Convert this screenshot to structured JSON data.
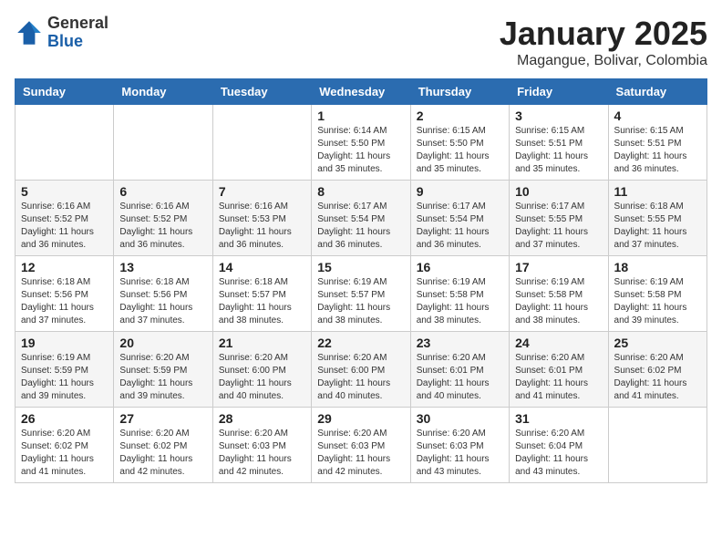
{
  "logo": {
    "general": "General",
    "blue": "Blue"
  },
  "title": "January 2025",
  "location": "Magangue, Bolivar, Colombia",
  "days_of_week": [
    "Sunday",
    "Monday",
    "Tuesday",
    "Wednesday",
    "Thursday",
    "Friday",
    "Saturday"
  ],
  "weeks": [
    [
      {
        "day": "",
        "info": ""
      },
      {
        "day": "",
        "info": ""
      },
      {
        "day": "",
        "info": ""
      },
      {
        "day": "1",
        "info": "Sunrise: 6:14 AM\nSunset: 5:50 PM\nDaylight: 11 hours\nand 35 minutes."
      },
      {
        "day": "2",
        "info": "Sunrise: 6:15 AM\nSunset: 5:50 PM\nDaylight: 11 hours\nand 35 minutes."
      },
      {
        "day": "3",
        "info": "Sunrise: 6:15 AM\nSunset: 5:51 PM\nDaylight: 11 hours\nand 35 minutes."
      },
      {
        "day": "4",
        "info": "Sunrise: 6:15 AM\nSunset: 5:51 PM\nDaylight: 11 hours\nand 36 minutes."
      }
    ],
    [
      {
        "day": "5",
        "info": "Sunrise: 6:16 AM\nSunset: 5:52 PM\nDaylight: 11 hours\nand 36 minutes."
      },
      {
        "day": "6",
        "info": "Sunrise: 6:16 AM\nSunset: 5:52 PM\nDaylight: 11 hours\nand 36 minutes."
      },
      {
        "day": "7",
        "info": "Sunrise: 6:16 AM\nSunset: 5:53 PM\nDaylight: 11 hours\nand 36 minutes."
      },
      {
        "day": "8",
        "info": "Sunrise: 6:17 AM\nSunset: 5:54 PM\nDaylight: 11 hours\nand 36 minutes."
      },
      {
        "day": "9",
        "info": "Sunrise: 6:17 AM\nSunset: 5:54 PM\nDaylight: 11 hours\nand 36 minutes."
      },
      {
        "day": "10",
        "info": "Sunrise: 6:17 AM\nSunset: 5:55 PM\nDaylight: 11 hours\nand 37 minutes."
      },
      {
        "day": "11",
        "info": "Sunrise: 6:18 AM\nSunset: 5:55 PM\nDaylight: 11 hours\nand 37 minutes."
      }
    ],
    [
      {
        "day": "12",
        "info": "Sunrise: 6:18 AM\nSunset: 5:56 PM\nDaylight: 11 hours\nand 37 minutes."
      },
      {
        "day": "13",
        "info": "Sunrise: 6:18 AM\nSunset: 5:56 PM\nDaylight: 11 hours\nand 37 minutes."
      },
      {
        "day": "14",
        "info": "Sunrise: 6:18 AM\nSunset: 5:57 PM\nDaylight: 11 hours\nand 38 minutes."
      },
      {
        "day": "15",
        "info": "Sunrise: 6:19 AM\nSunset: 5:57 PM\nDaylight: 11 hours\nand 38 minutes."
      },
      {
        "day": "16",
        "info": "Sunrise: 6:19 AM\nSunset: 5:58 PM\nDaylight: 11 hours\nand 38 minutes."
      },
      {
        "day": "17",
        "info": "Sunrise: 6:19 AM\nSunset: 5:58 PM\nDaylight: 11 hours\nand 38 minutes."
      },
      {
        "day": "18",
        "info": "Sunrise: 6:19 AM\nSunset: 5:58 PM\nDaylight: 11 hours\nand 39 minutes."
      }
    ],
    [
      {
        "day": "19",
        "info": "Sunrise: 6:19 AM\nSunset: 5:59 PM\nDaylight: 11 hours\nand 39 minutes."
      },
      {
        "day": "20",
        "info": "Sunrise: 6:20 AM\nSunset: 5:59 PM\nDaylight: 11 hours\nand 39 minutes."
      },
      {
        "day": "21",
        "info": "Sunrise: 6:20 AM\nSunset: 6:00 PM\nDaylight: 11 hours\nand 40 minutes."
      },
      {
        "day": "22",
        "info": "Sunrise: 6:20 AM\nSunset: 6:00 PM\nDaylight: 11 hours\nand 40 minutes."
      },
      {
        "day": "23",
        "info": "Sunrise: 6:20 AM\nSunset: 6:01 PM\nDaylight: 11 hours\nand 40 minutes."
      },
      {
        "day": "24",
        "info": "Sunrise: 6:20 AM\nSunset: 6:01 PM\nDaylight: 11 hours\nand 41 minutes."
      },
      {
        "day": "25",
        "info": "Sunrise: 6:20 AM\nSunset: 6:02 PM\nDaylight: 11 hours\nand 41 minutes."
      }
    ],
    [
      {
        "day": "26",
        "info": "Sunrise: 6:20 AM\nSunset: 6:02 PM\nDaylight: 11 hours\nand 41 minutes."
      },
      {
        "day": "27",
        "info": "Sunrise: 6:20 AM\nSunset: 6:02 PM\nDaylight: 11 hours\nand 42 minutes."
      },
      {
        "day": "28",
        "info": "Sunrise: 6:20 AM\nSunset: 6:03 PM\nDaylight: 11 hours\nand 42 minutes."
      },
      {
        "day": "29",
        "info": "Sunrise: 6:20 AM\nSunset: 6:03 PM\nDaylight: 11 hours\nand 42 minutes."
      },
      {
        "day": "30",
        "info": "Sunrise: 6:20 AM\nSunset: 6:03 PM\nDaylight: 11 hours\nand 43 minutes."
      },
      {
        "day": "31",
        "info": "Sunrise: 6:20 AM\nSunset: 6:04 PM\nDaylight: 11 hours\nand 43 minutes."
      },
      {
        "day": "",
        "info": ""
      }
    ]
  ]
}
